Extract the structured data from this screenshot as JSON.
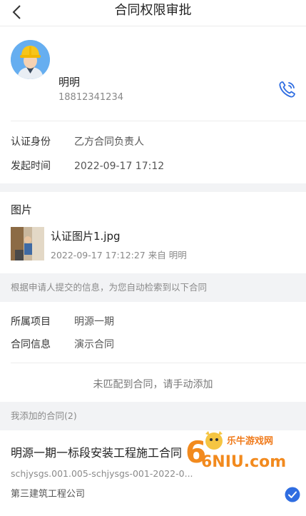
{
  "header": {
    "title": "合同权限审批",
    "back_icon": "chevron-left-icon"
  },
  "user": {
    "name": "明明",
    "phone": "18812341234",
    "phone_icon": "phone-call-icon",
    "fields": [
      {
        "key": "认证身份",
        "value": "乙方合同负责人"
      },
      {
        "key": "发起时间",
        "value": "2022-09-17 17:12"
      }
    ]
  },
  "pictures": {
    "title": "图片",
    "file": {
      "name": "认证图片1.jpg",
      "meta": "2022-09-17 17:12:27 来自 明明"
    }
  },
  "hint": "根据申请人提交的信息，为您自动检索到以下合同",
  "match": {
    "fields": [
      {
        "key": "所属项目",
        "value": "明源一期"
      },
      {
        "key": "合同信息",
        "value": "演示合同"
      }
    ],
    "no_match_text": "未匹配到合同，请手动添加"
  },
  "added": {
    "header": "我添加的合同(2)",
    "contract": {
      "title": "明源一期一标段安装工程施工合同",
      "code": "schjysgs.001.005-schjysgs-001-2022-0...",
      "company": "第三建筑工程公司",
      "checked": true
    }
  },
  "watermark": {
    "text": "乐牛游戏网",
    "sub": "6NIU.com"
  },
  "colors": {
    "accent": "#2f6de1",
    "page_bg": "#f2f3f5",
    "watermark": "#f07a1a"
  }
}
